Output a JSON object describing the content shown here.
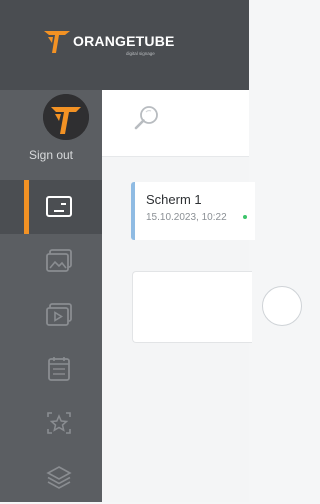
{
  "brand": {
    "name": "ORANGETUBE",
    "tagline": "digital signage",
    "accent_color": "#f39224"
  },
  "sidebar": {
    "sign_out_label": "Sign out",
    "items": [
      {
        "icon": "screens-icon",
        "active": true
      },
      {
        "icon": "images-icon",
        "active": false
      },
      {
        "icon": "videos-icon",
        "active": false
      },
      {
        "icon": "schedule-icon",
        "active": false
      },
      {
        "icon": "favorites-icon",
        "active": false
      },
      {
        "icon": "layers-icon",
        "active": false
      }
    ]
  },
  "search": {
    "icon": "search-icon"
  },
  "screens": [
    {
      "name": "Scherm 1",
      "updated": "15.10.2023, 10:22",
      "status_color": "#3cc46a"
    }
  ]
}
